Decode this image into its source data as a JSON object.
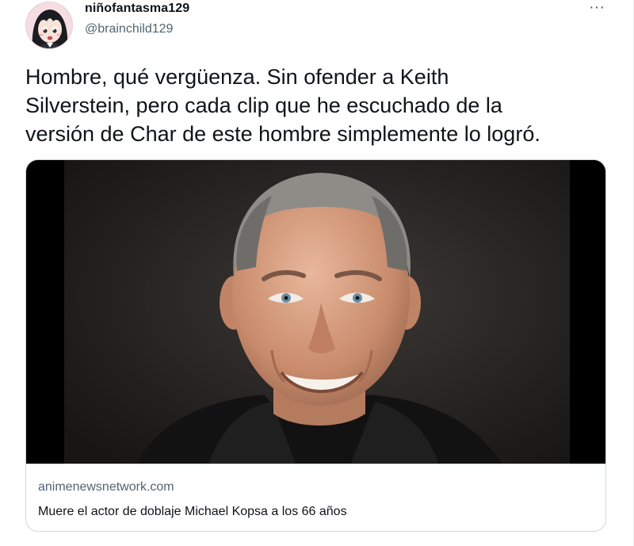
{
  "tweet": {
    "author": {
      "display_name": "niñofantasma129",
      "handle": "@brainchild129",
      "avatar_icon": "anime-girl-avatar"
    },
    "more_label": "···",
    "text_lines": [
      "Hombre, qué vergüenza. Sin ofender a Keith",
      "Silverstein, pero cada clip que he escuchado de la",
      "versión de Char de este hombre simplemente lo logró."
    ],
    "card": {
      "image_icon": "smiling-man-portrait",
      "domain": "animenewsnetwork.com",
      "title": "Muere el actor de doblaje Michael Kopsa a los 66 años"
    }
  },
  "colors": {
    "text_primary": "#0f1419",
    "text_secondary": "#536471",
    "border": "#cfd9de"
  }
}
